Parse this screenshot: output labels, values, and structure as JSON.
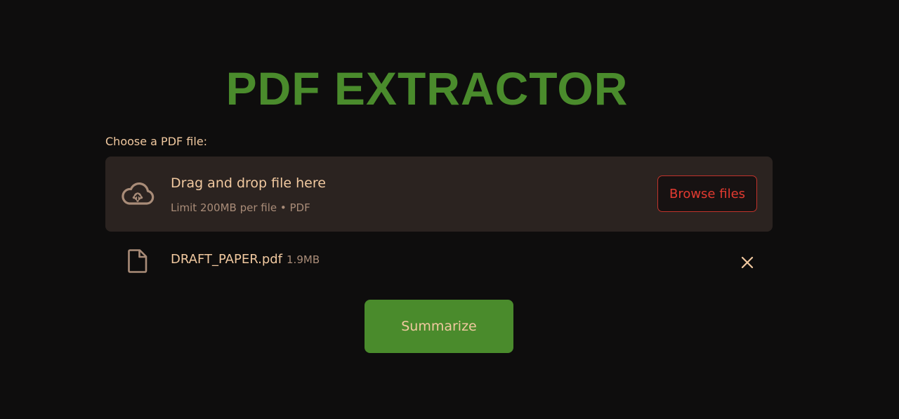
{
  "header": {
    "title": "PDF EXTRACTOR"
  },
  "uploader": {
    "label": "Choose a PDF file:",
    "dropzone_title": "Drag and drop file here",
    "dropzone_subtitle": "Limit 200MB per file • PDF",
    "browse_label": "Browse files",
    "upload_icon": "cloud-upload-icon"
  },
  "uploaded_file": {
    "name": "DRAFT_PAPER.pdf",
    "size": "1.9MB",
    "file_icon": "file-icon",
    "remove_icon": "close-icon"
  },
  "actions": {
    "summarize_label": "Summarize"
  },
  "colors": {
    "background": "#0e0d0d",
    "accent_green": "#4a8b2c",
    "text_peach": "#f1c9a0",
    "muted_text": "#a98c78",
    "dropzone_bg": "#2b2320",
    "browse_red": "#e23a30"
  }
}
